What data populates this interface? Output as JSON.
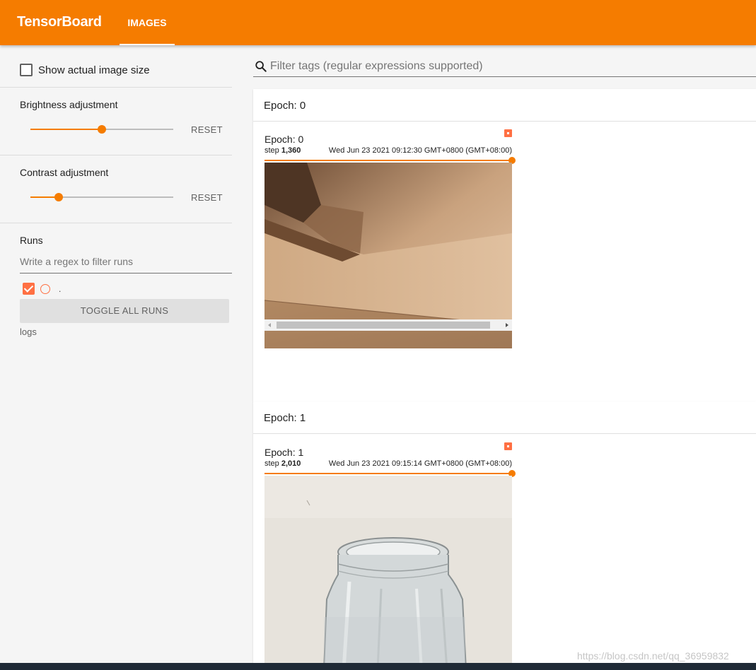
{
  "header": {
    "brand": "TensorBoard",
    "tabs": [
      {
        "label": "IMAGES",
        "active": true
      }
    ],
    "color": "#f57c00"
  },
  "sidebar": {
    "show_actual_size": {
      "label": "Show actual image size",
      "checked": false
    },
    "brightness": {
      "label": "Brightness adjustment",
      "value_fraction": 0.5,
      "reset_label": "RESET"
    },
    "contrast": {
      "label": "Contrast adjustment",
      "value_fraction": 0.2,
      "reset_label": "RESET"
    },
    "runs": {
      "title": "Runs",
      "filter_placeholder": "Write a regex to filter runs",
      "items": [
        {
          "name": ".",
          "checked": true,
          "color": "#ff7043"
        }
      ],
      "toggle_label": "TOGGLE ALL RUNS",
      "logdir": "logs"
    }
  },
  "main": {
    "filter_placeholder": "Filter tags (regular expressions supported)",
    "cards": [
      {
        "title": "Epoch: 0",
        "image": {
          "tag": "Epoch: 0",
          "step_label": "step",
          "step": "1,360",
          "time": "Wed Jun 23 2021 09:12:30 GMT+0800 (GMT+08:00)",
          "subject": "cardboard-box"
        }
      },
      {
        "title": "Epoch: 1",
        "image": {
          "tag": "Epoch: 1",
          "step_label": "step",
          "step": "2,010",
          "time": "Wed Jun 23 2021 09:15:14 GMT+0800 (GMT+08:00)",
          "subject": "glass-jar"
        }
      }
    ]
  },
  "watermark": "https://blog.csdn.net/qq_36959832"
}
